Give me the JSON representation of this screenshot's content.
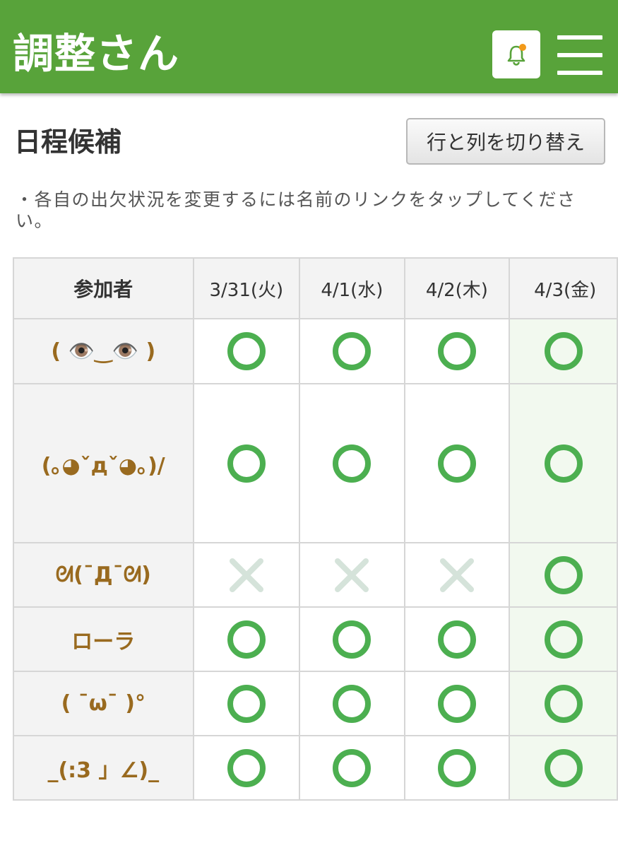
{
  "header": {
    "logo": "調整さん",
    "bell_icon": "bell-icon",
    "menu_icon": "hamburger-menu-icon",
    "brand_color": "#58a33a"
  },
  "schedule": {
    "title": "日程候補",
    "switch_label": "行と列を切り替え",
    "notice": "・各自の出欠状況を変更するには名前のリンクをタップしてください。"
  },
  "table": {
    "name_header": "参加者",
    "dates": [
      "3/31(火)",
      "4/1(水)",
      "4/2(木)",
      "4/3(金)"
    ],
    "rows": [
      {
        "name": "( 👁️‿👁️ )",
        "marks": [
          "○",
          "○",
          "○",
          "○"
        ]
      },
      {
        "name": "(｡◕ˇдˇ◕｡)/",
        "marks": [
          "○",
          "○",
          "○",
          "○"
        ]
      },
      {
        "name": "ᘛ(¯Д¯ᘛ)",
        "marks": [
          "×",
          "×",
          "×",
          "○"
        ]
      },
      {
        "name": "ローラ",
        "marks": [
          "○",
          "○",
          "○",
          "○"
        ]
      },
      {
        "name": "( ¯ω¯ )°",
        "marks": [
          "○",
          "○",
          "○",
          "○"
        ]
      },
      {
        "name": "_(:3 」∠)_",
        "marks": [
          "○",
          "○",
          "○",
          "○"
        ]
      }
    ],
    "highlight_color": "#f2f9ef",
    "ok_color": "#4caf50",
    "ng_color": "#d5e3da"
  }
}
